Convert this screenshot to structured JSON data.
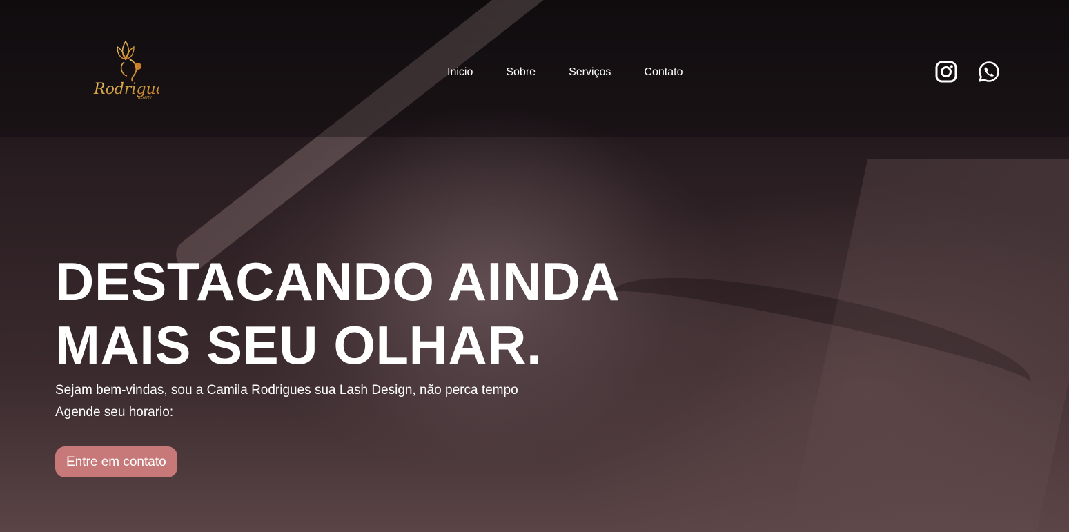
{
  "brand": {
    "logo_text": "Rodrigues",
    "logo_subtext": "BEAUTY",
    "logo_icon": "lotus-woman-icon",
    "gold_color": "#c9993a"
  },
  "nav": {
    "items": [
      "Inicio",
      "Sobre",
      "Serviços",
      "Contato"
    ]
  },
  "social": {
    "instagram_icon": "instagram-icon",
    "whatsapp_icon": "whatsapp-icon"
  },
  "hero": {
    "title_line1": "DESTACANDO AINDA",
    "title_line2": "MAIS SEU OLHAR.",
    "subtitle_line1": "Sejam bem-vindas, sou a Camila Rodrigues sua Lash Design, não perca tempo",
    "subtitle_line2": "Agende seu horario:",
    "cta_label": "Entre em contato",
    "cta_color": "#c77878"
  }
}
